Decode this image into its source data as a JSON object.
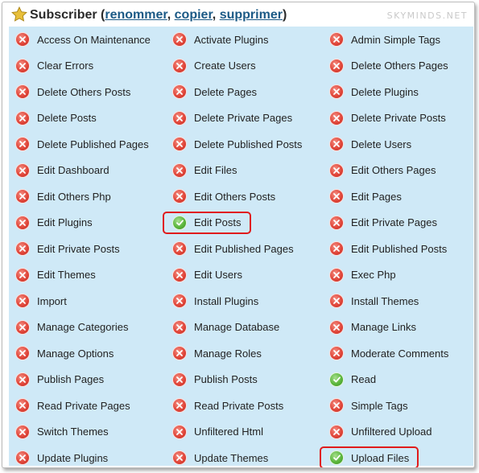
{
  "role": {
    "name": "Subscriber",
    "open_paren": "(",
    "close_paren": ")",
    "comma": ",",
    "actions": [
      "renommer",
      "copier",
      "supprimer"
    ]
  },
  "watermark": "SKYMINDS.NET",
  "status_icons": {
    "granted": "check-icon",
    "denied": "cross-icon"
  },
  "colors": {
    "panel_bg": "#cfe9f7",
    "deny": "#e1473b",
    "allow": "#5bb63c",
    "highlight": "#e01b1b",
    "link": "#1c5a86"
  },
  "capabilities": [
    [
      {
        "label": "Access On Maintenance",
        "granted": false
      },
      {
        "label": "Clear Errors",
        "granted": false
      },
      {
        "label": "Delete Others Posts",
        "granted": false
      },
      {
        "label": "Delete Posts",
        "granted": false
      },
      {
        "label": "Delete Published Pages",
        "granted": false
      },
      {
        "label": "Edit Dashboard",
        "granted": false
      },
      {
        "label": "Edit Others Php",
        "granted": false
      },
      {
        "label": "Edit Plugins",
        "granted": false
      },
      {
        "label": "Edit Private Posts",
        "granted": false
      },
      {
        "label": "Edit Themes",
        "granted": false
      },
      {
        "label": "Import",
        "granted": false
      },
      {
        "label": "Manage Categories",
        "granted": false
      },
      {
        "label": "Manage Options",
        "granted": false
      },
      {
        "label": "Publish Pages",
        "granted": false
      },
      {
        "label": "Read Private Pages",
        "granted": false
      },
      {
        "label": "Switch Themes",
        "granted": false
      },
      {
        "label": "Update Plugins",
        "granted": false
      }
    ],
    [
      {
        "label": "Activate Plugins",
        "granted": false
      },
      {
        "label": "Create Users",
        "granted": false
      },
      {
        "label": "Delete Pages",
        "granted": false
      },
      {
        "label": "Delete Private Pages",
        "granted": false
      },
      {
        "label": "Delete Published Posts",
        "granted": false
      },
      {
        "label": "Edit Files",
        "granted": false
      },
      {
        "label": "Edit Others Posts",
        "granted": false
      },
      {
        "label": "Edit Posts",
        "granted": true,
        "highlighted": true
      },
      {
        "label": "Edit Published Pages",
        "granted": false
      },
      {
        "label": "Edit Users",
        "granted": false
      },
      {
        "label": "Install Plugins",
        "granted": false
      },
      {
        "label": "Manage Database",
        "granted": false
      },
      {
        "label": "Manage Roles",
        "granted": false
      },
      {
        "label": "Publish Posts",
        "granted": false
      },
      {
        "label": "Read Private Posts",
        "granted": false
      },
      {
        "label": "Unfiltered Html",
        "granted": false
      },
      {
        "label": "Update Themes",
        "granted": false
      }
    ],
    [
      {
        "label": "Admin Simple Tags",
        "granted": false
      },
      {
        "label": "Delete Others Pages",
        "granted": false
      },
      {
        "label": "Delete Plugins",
        "granted": false
      },
      {
        "label": "Delete Private Posts",
        "granted": false
      },
      {
        "label": "Delete Users",
        "granted": false
      },
      {
        "label": "Edit Others Pages",
        "granted": false
      },
      {
        "label": "Edit Pages",
        "granted": false
      },
      {
        "label": "Edit Private Pages",
        "granted": false
      },
      {
        "label": "Edit Published Posts",
        "granted": false
      },
      {
        "label": "Exec Php",
        "granted": false
      },
      {
        "label": "Install Themes",
        "granted": false
      },
      {
        "label": "Manage Links",
        "granted": false
      },
      {
        "label": "Moderate Comments",
        "granted": false
      },
      {
        "label": "Read",
        "granted": true
      },
      {
        "label": "Simple Tags",
        "granted": false
      },
      {
        "label": "Unfiltered Upload",
        "granted": false
      },
      {
        "label": "Upload Files",
        "granted": true,
        "highlighted": true
      }
    ]
  ]
}
